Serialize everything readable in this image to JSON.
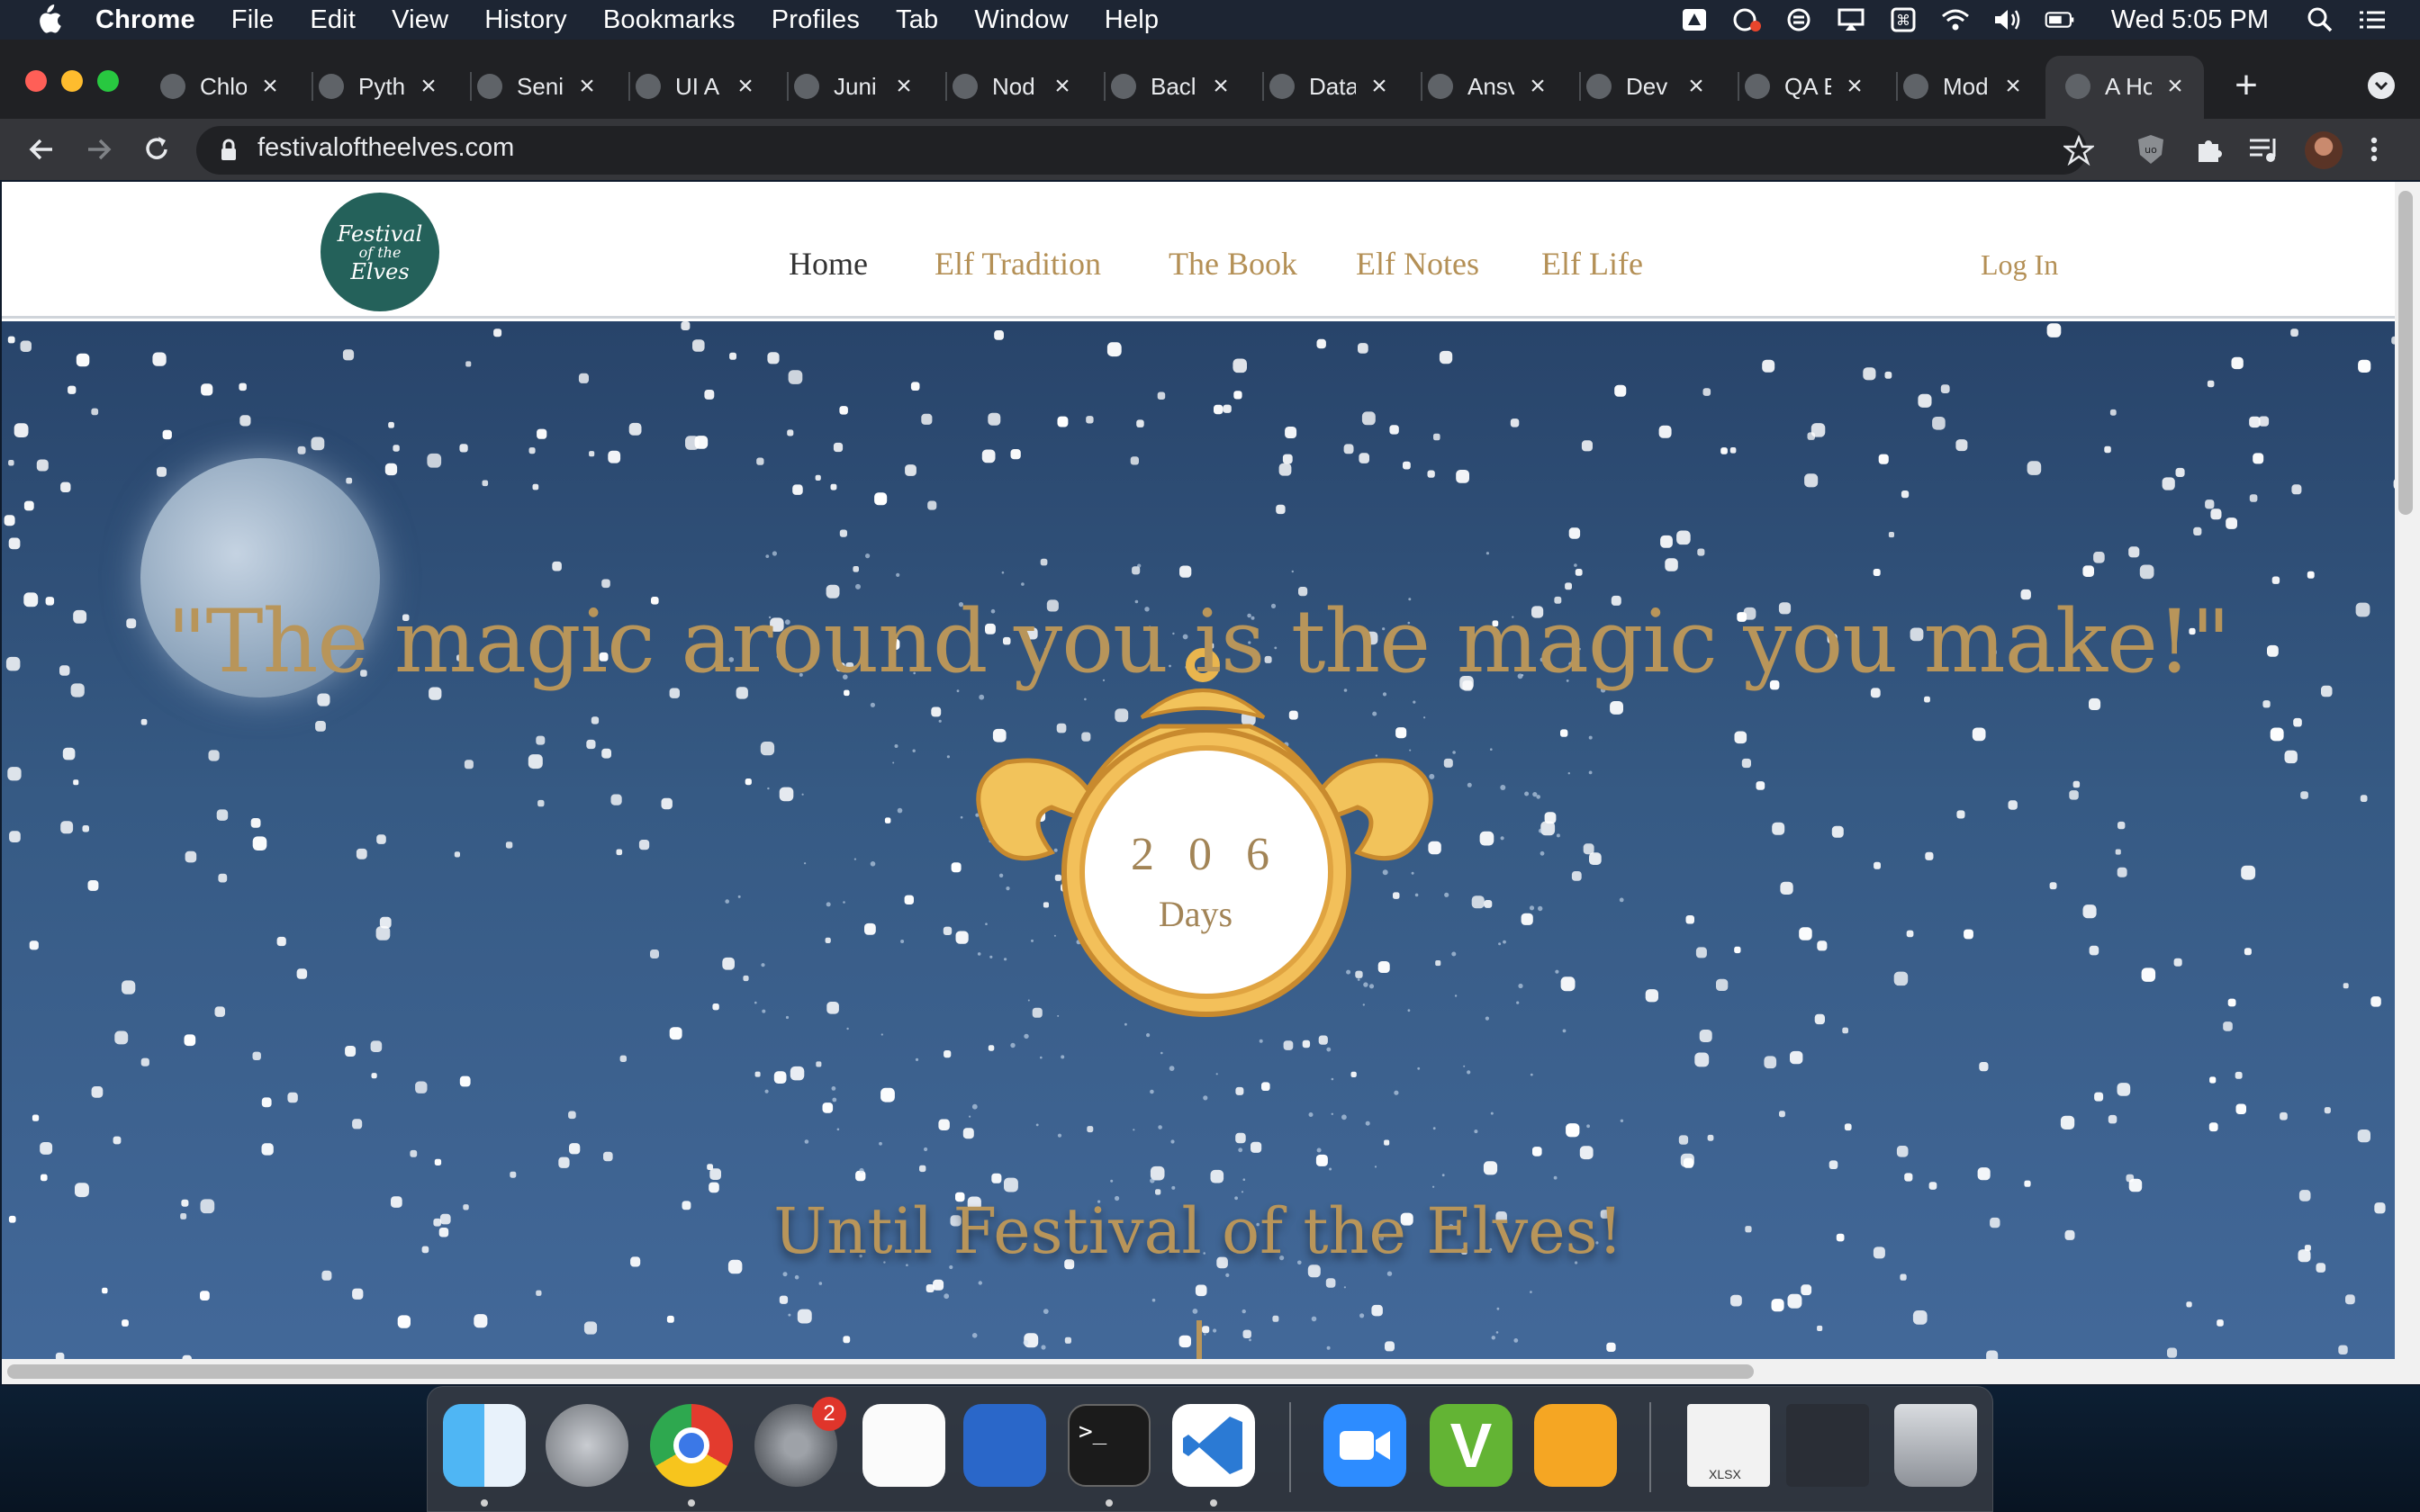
{
  "menubar": {
    "app_name": "Chrome",
    "items": [
      "File",
      "Edit",
      "View",
      "History",
      "Bookmarks",
      "Profiles",
      "Tab",
      "Window",
      "Help"
    ],
    "clock": "Wed 5:05 PM"
  },
  "tabs": [
    {
      "label": "Chlo"
    },
    {
      "label": "Pyth"
    },
    {
      "label": "Seni"
    },
    {
      "label": "UI A"
    },
    {
      "label": "Juni"
    },
    {
      "label": "Nod"
    },
    {
      "label": "Bacl"
    },
    {
      "label": "Data"
    },
    {
      "label": "Ansv"
    },
    {
      "label": "Dev"
    },
    {
      "label": "QA E"
    },
    {
      "label": "Mod"
    },
    {
      "label": "A Ho"
    }
  ],
  "address_bar": {
    "url": "festivaloftheelves.com"
  },
  "site": {
    "logo_text": [
      "Festival",
      "of the",
      "Elves"
    ],
    "nav": [
      "Home",
      "Elf Tradition",
      "The Book",
      "Elf Notes",
      "Elf Life"
    ],
    "login": "Log In",
    "quote": "\"The magic around you is the magic you make!\"",
    "countdown_number": "206",
    "countdown_label": "Days",
    "until_text": "Until Festival of the Elves!"
  },
  "dock": {
    "apps": [
      "finder-icon",
      "launchpad-icon",
      "chrome-icon",
      "system-preferences-icon",
      "reminders-icon",
      "controller-icon",
      "terminal-icon",
      "vscode-icon",
      "zoom-icon",
      "vectorworks-icon",
      "pages-icon",
      "spreadsheet-file-icon",
      "screenshot-file-icon",
      "trash-icon"
    ],
    "badge_count": "2",
    "spreadsheet_label": "XLSX"
  },
  "colors": {
    "gold": "#b8955a",
    "hero_blue": "#365a84",
    "logo_teal": "#24615a"
  }
}
